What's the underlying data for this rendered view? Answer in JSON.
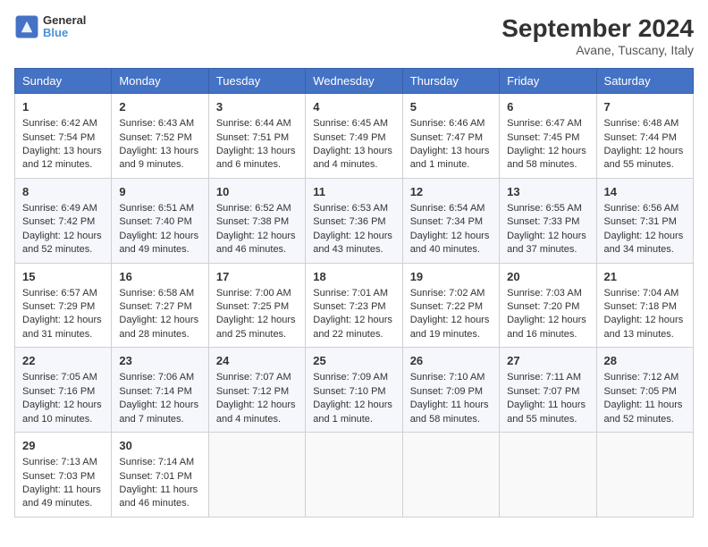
{
  "header": {
    "logo_general": "General",
    "logo_blue": "Blue",
    "title": "September 2024",
    "subtitle": "Avane, Tuscany, Italy"
  },
  "columns": [
    "Sunday",
    "Monday",
    "Tuesday",
    "Wednesday",
    "Thursday",
    "Friday",
    "Saturday"
  ],
  "weeks": [
    [
      {
        "day": "1",
        "lines": [
          "Sunrise: 6:42 AM",
          "Sunset: 7:54 PM",
          "Daylight: 13 hours",
          "and 12 minutes."
        ]
      },
      {
        "day": "2",
        "lines": [
          "Sunrise: 6:43 AM",
          "Sunset: 7:52 PM",
          "Daylight: 13 hours",
          "and 9 minutes."
        ]
      },
      {
        "day": "3",
        "lines": [
          "Sunrise: 6:44 AM",
          "Sunset: 7:51 PM",
          "Daylight: 13 hours",
          "and 6 minutes."
        ]
      },
      {
        "day": "4",
        "lines": [
          "Sunrise: 6:45 AM",
          "Sunset: 7:49 PM",
          "Daylight: 13 hours",
          "and 4 minutes."
        ]
      },
      {
        "day": "5",
        "lines": [
          "Sunrise: 6:46 AM",
          "Sunset: 7:47 PM",
          "Daylight: 13 hours",
          "and 1 minute."
        ]
      },
      {
        "day": "6",
        "lines": [
          "Sunrise: 6:47 AM",
          "Sunset: 7:45 PM",
          "Daylight: 12 hours",
          "and 58 minutes."
        ]
      },
      {
        "day": "7",
        "lines": [
          "Sunrise: 6:48 AM",
          "Sunset: 7:44 PM",
          "Daylight: 12 hours",
          "and 55 minutes."
        ]
      }
    ],
    [
      {
        "day": "8",
        "lines": [
          "Sunrise: 6:49 AM",
          "Sunset: 7:42 PM",
          "Daylight: 12 hours",
          "and 52 minutes."
        ]
      },
      {
        "day": "9",
        "lines": [
          "Sunrise: 6:51 AM",
          "Sunset: 7:40 PM",
          "Daylight: 12 hours",
          "and 49 minutes."
        ]
      },
      {
        "day": "10",
        "lines": [
          "Sunrise: 6:52 AM",
          "Sunset: 7:38 PM",
          "Daylight: 12 hours",
          "and 46 minutes."
        ]
      },
      {
        "day": "11",
        "lines": [
          "Sunrise: 6:53 AM",
          "Sunset: 7:36 PM",
          "Daylight: 12 hours",
          "and 43 minutes."
        ]
      },
      {
        "day": "12",
        "lines": [
          "Sunrise: 6:54 AM",
          "Sunset: 7:34 PM",
          "Daylight: 12 hours",
          "and 40 minutes."
        ]
      },
      {
        "day": "13",
        "lines": [
          "Sunrise: 6:55 AM",
          "Sunset: 7:33 PM",
          "Daylight: 12 hours",
          "and 37 minutes."
        ]
      },
      {
        "day": "14",
        "lines": [
          "Sunrise: 6:56 AM",
          "Sunset: 7:31 PM",
          "Daylight: 12 hours",
          "and 34 minutes."
        ]
      }
    ],
    [
      {
        "day": "15",
        "lines": [
          "Sunrise: 6:57 AM",
          "Sunset: 7:29 PM",
          "Daylight: 12 hours",
          "and 31 minutes."
        ]
      },
      {
        "day": "16",
        "lines": [
          "Sunrise: 6:58 AM",
          "Sunset: 7:27 PM",
          "Daylight: 12 hours",
          "and 28 minutes."
        ]
      },
      {
        "day": "17",
        "lines": [
          "Sunrise: 7:00 AM",
          "Sunset: 7:25 PM",
          "Daylight: 12 hours",
          "and 25 minutes."
        ]
      },
      {
        "day": "18",
        "lines": [
          "Sunrise: 7:01 AM",
          "Sunset: 7:23 PM",
          "Daylight: 12 hours",
          "and 22 minutes."
        ]
      },
      {
        "day": "19",
        "lines": [
          "Sunrise: 7:02 AM",
          "Sunset: 7:22 PM",
          "Daylight: 12 hours",
          "and 19 minutes."
        ]
      },
      {
        "day": "20",
        "lines": [
          "Sunrise: 7:03 AM",
          "Sunset: 7:20 PM",
          "Daylight: 12 hours",
          "and 16 minutes."
        ]
      },
      {
        "day": "21",
        "lines": [
          "Sunrise: 7:04 AM",
          "Sunset: 7:18 PM",
          "Daylight: 12 hours",
          "and 13 minutes."
        ]
      }
    ],
    [
      {
        "day": "22",
        "lines": [
          "Sunrise: 7:05 AM",
          "Sunset: 7:16 PM",
          "Daylight: 12 hours",
          "and 10 minutes."
        ]
      },
      {
        "day": "23",
        "lines": [
          "Sunrise: 7:06 AM",
          "Sunset: 7:14 PM",
          "Daylight: 12 hours",
          "and 7 minutes."
        ]
      },
      {
        "day": "24",
        "lines": [
          "Sunrise: 7:07 AM",
          "Sunset: 7:12 PM",
          "Daylight: 12 hours",
          "and 4 minutes."
        ]
      },
      {
        "day": "25",
        "lines": [
          "Sunrise: 7:09 AM",
          "Sunset: 7:10 PM",
          "Daylight: 12 hours",
          "and 1 minute."
        ]
      },
      {
        "day": "26",
        "lines": [
          "Sunrise: 7:10 AM",
          "Sunset: 7:09 PM",
          "Daylight: 11 hours",
          "and 58 minutes."
        ]
      },
      {
        "day": "27",
        "lines": [
          "Sunrise: 7:11 AM",
          "Sunset: 7:07 PM",
          "Daylight: 11 hours",
          "and 55 minutes."
        ]
      },
      {
        "day": "28",
        "lines": [
          "Sunrise: 7:12 AM",
          "Sunset: 7:05 PM",
          "Daylight: 11 hours",
          "and 52 minutes."
        ]
      }
    ],
    [
      {
        "day": "29",
        "lines": [
          "Sunrise: 7:13 AM",
          "Sunset: 7:03 PM",
          "Daylight: 11 hours",
          "and 49 minutes."
        ]
      },
      {
        "day": "30",
        "lines": [
          "Sunrise: 7:14 AM",
          "Sunset: 7:01 PM",
          "Daylight: 11 hours",
          "and 46 minutes."
        ]
      },
      {
        "day": "",
        "lines": []
      },
      {
        "day": "",
        "lines": []
      },
      {
        "day": "",
        "lines": []
      },
      {
        "day": "",
        "lines": []
      },
      {
        "day": "",
        "lines": []
      }
    ]
  ]
}
